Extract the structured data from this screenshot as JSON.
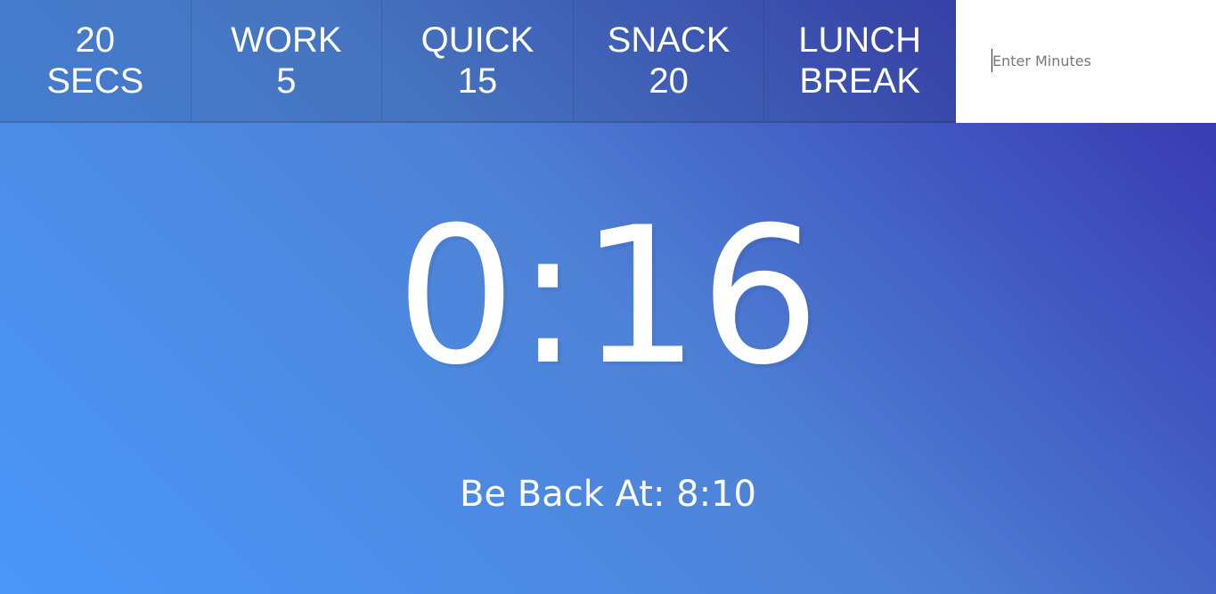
{
  "controls": {
    "buttons": [
      {
        "label": "20 SECS"
      },
      {
        "label": "WORK 5"
      },
      {
        "label": "QUICK 15"
      },
      {
        "label": "SNACK 20"
      },
      {
        "label": "LUNCH BREAK"
      }
    ],
    "custom": {
      "placeholder": "Enter Minutes",
      "value": ""
    }
  },
  "display": {
    "time_left": "0:16",
    "end_time": "Be Back At: 8:10"
  },
  "colors": {
    "gradient_start": "#4a97fa",
    "gradient_mid": "#4e82d6",
    "gradient_end": "#3630ad",
    "text": "#ffffff"
  }
}
